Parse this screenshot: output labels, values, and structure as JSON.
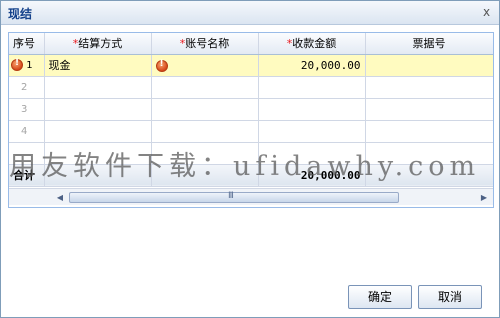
{
  "window": {
    "title": "现结",
    "close_label": "x"
  },
  "grid": {
    "columns": [
      {
        "label": "序号",
        "required": false
      },
      {
        "label": "结算方式",
        "required": true
      },
      {
        "label": "账号名称",
        "required": true
      },
      {
        "label": "收款金额",
        "required": true
      },
      {
        "label": "票据号",
        "required": false
      }
    ],
    "required_mark": "*",
    "rows": [
      {
        "seq": "1",
        "method": "现金",
        "account": "",
        "amount": "20,000.00",
        "bill": "",
        "selected": true,
        "warning": true
      },
      {
        "seq": "2",
        "method": "",
        "account": "",
        "amount": "",
        "bill": ""
      },
      {
        "seq": "3",
        "method": "",
        "account": "",
        "amount": "",
        "bill": ""
      },
      {
        "seq": "4",
        "method": "",
        "account": "",
        "amount": "",
        "bill": ""
      }
    ],
    "total": {
      "label": "合计",
      "amount": "20,000.00"
    },
    "scroll_grip": "III"
  },
  "watermark": "用友软件下载：ufidawhy.com",
  "buttons": {
    "ok": "确定",
    "cancel": "取消"
  },
  "icons": {
    "row_warning": "warning-circle-icon",
    "account_warning": "warning-circle-icon",
    "close": "close-icon"
  }
}
